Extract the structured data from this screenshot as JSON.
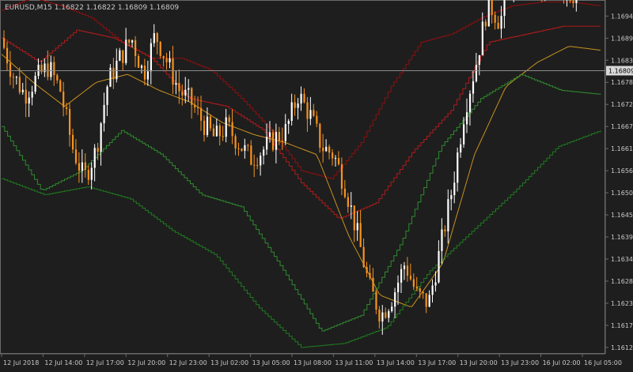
{
  "window": {
    "title": "EURUSD,M15  1.16822 1.16822 1.16809 1.16809"
  },
  "colors": {
    "background": "#1e1e1e",
    "grid": "#6a6a6a",
    "text": "#c8c8c8",
    "bull": "#ffffff",
    "bear": "#f7931e",
    "upper_outer": "#8b0f0f",
    "upper_inner": "#b01a1a",
    "lower_inner": "#2e8b2e",
    "lower_outer": "#1f7a1f",
    "middle": "#c8921e",
    "price_line": "#8c8c8c",
    "price_box_bg": "#d8d8d8",
    "price_box_text": "#000000"
  },
  "chart_data": {
    "type": "candlestick",
    "symbol": "EURUSD",
    "timeframe": "M15",
    "ohlc_header": [
      "1.16822",
      "1.16822",
      "1.16809",
      "1.16809"
    ],
    "current_price": "1.16809",
    "ylim": [
      1.16104,
      1.16985
    ],
    "y_ticks": [
      "1.16945",
      "1.16890",
      "1.16835",
      "1.16780",
      "1.16725",
      "1.16670",
      "1.16615",
      "1.16560",
      "1.16505",
      "1.16450",
      "1.16395",
      "1.16340",
      "1.16285",
      "1.16230",
      "1.16175",
      "1.16120"
    ],
    "x_ticks": [
      "12 Jul 2018",
      "12 Jul 14:00",
      "12 Jul 17:00",
      "12 Jul 20:00",
      "12 Jul 23:00",
      "13 Jul 02:00",
      "13 Jul 05:00",
      "13 Jul 08:00",
      "13 Jul 11:00",
      "13 Jul 14:00",
      "13 Jul 17:00",
      "13 Jul 20:00",
      "13 Jul 23:00",
      "16 Jul 02:00",
      "16 Jul 05:00"
    ],
    "close_path": [
      1.1689,
      1.168,
      1.1675,
      1.1679,
      1.1682,
      1.1676,
      1.1662,
      1.1654,
      1.1661,
      1.1678,
      1.1684,
      1.1689,
      1.168,
      1.169,
      1.1683,
      1.1676,
      1.1673,
      1.1668,
      1.1664,
      1.1667,
      1.1663,
      1.1659,
      1.1661,
      1.1664,
      1.1666,
      1.1675,
      1.167,
      1.1662,
      1.166,
      1.1652,
      1.164,
      1.1627,
      1.162,
      1.1625,
      1.1633,
      1.1625,
      1.1623,
      1.1637,
      1.1652,
      1.1671,
      1.1683,
      1.1698,
      1.1693,
      1.1704,
      1.171,
      1.1701,
      1.17,
      1.1702,
      1.17,
      1.1701,
      1.1702
    ],
    "bands": {
      "upper_outer": [
        1.1696,
        1.1699,
        1.1697,
        1.1694,
        1.1688,
        1.1684,
        1.1684,
        1.1681,
        1.1674,
        1.1666,
        1.1656,
        1.1654,
        1.1663,
        1.1677,
        1.1688,
        1.169,
        1.1694,
        1.1697,
        1.1698,
        1.1698,
        1.1697
      ],
      "upper_inner": [
        1.1689,
        1.1683,
        1.1691,
        1.1689,
        1.1684,
        1.1674,
        1.1672,
        1.1666,
        1.1653,
        1.1644,
        1.1648,
        1.1661,
        1.1671,
        1.1688,
        1.169,
        1.1692,
        1.1692
      ],
      "middle": [
        1.1685,
        1.1678,
        1.1672,
        1.1678,
        1.168,
        1.1676,
        1.1673,
        1.1668,
        1.1665,
        1.1663,
        1.166,
        1.164,
        1.1625,
        1.1622,
        1.1633,
        1.166,
        1.1677,
        1.1683,
        1.1687,
        1.1686
      ],
      "lower_inner": [
        1.1667,
        1.1651,
        1.1656,
        1.1666,
        1.166,
        1.165,
        1.1647,
        1.1632,
        1.1616,
        1.162,
        1.1638,
        1.1662,
        1.1674,
        1.168,
        1.1676,
        1.1675
      ],
      "lower_outer": [
        1.1654,
        1.165,
        1.1652,
        1.1649,
        1.1641,
        1.1635,
        1.1622,
        1.1612,
        1.1613,
        1.1617,
        1.1631,
        1.1641,
        1.1651,
        1.1662,
        1.1666
      ]
    },
    "grid": false,
    "legend": "none"
  }
}
